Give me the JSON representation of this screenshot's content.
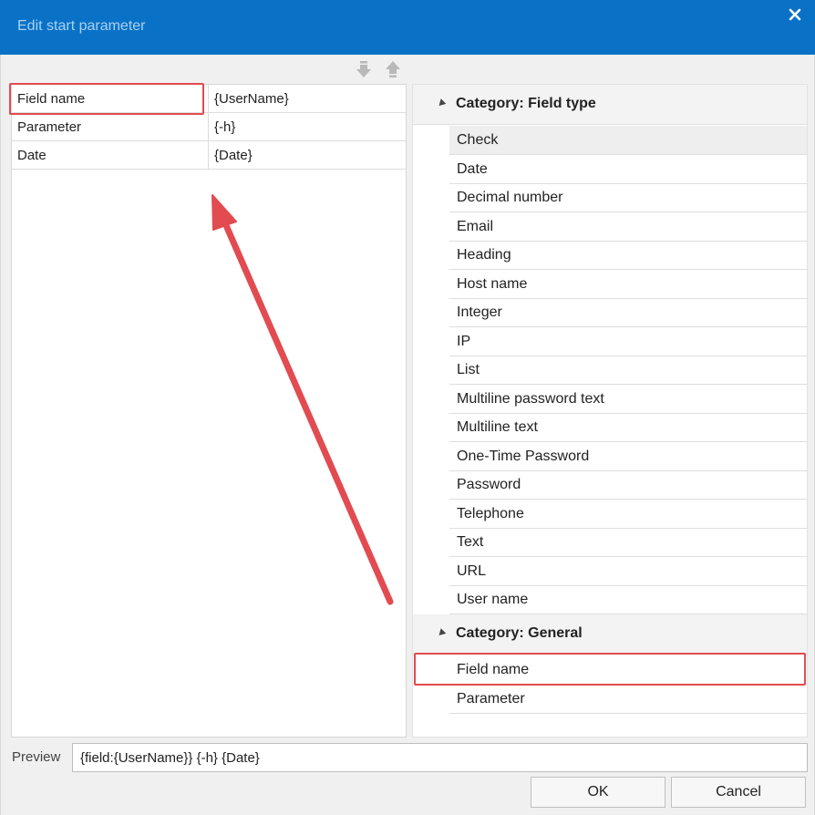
{
  "window": {
    "title": "Edit start parameter",
    "accent_color": "#0a72c6",
    "highlight_color": "#e24b50"
  },
  "toolbar": {
    "move_down_icon": "arrow-down-icon",
    "move_up_icon": "arrow-up-icon"
  },
  "parameters": [
    {
      "name": "Field name",
      "value": "{UserName}"
    },
    {
      "name": "Parameter",
      "value": "{-h}"
    },
    {
      "name": "Date",
      "value": "{Date}"
    }
  ],
  "categories": {
    "field_type": {
      "label": "Category: Field type",
      "items": [
        "Check",
        "Date",
        "Decimal number",
        "Email",
        "Heading",
        "Host name",
        "Integer",
        "IP",
        "List",
        "Multiline password text",
        "Multiline text",
        "One-Time Password",
        "Password",
        "Telephone",
        "Text",
        "URL",
        "User name"
      ]
    },
    "general": {
      "label": "Category: General",
      "items": [
        "Field name",
        "Parameter"
      ]
    }
  },
  "preview": {
    "label": "Preview",
    "value": "{field:{UserName}} {-h} {Date}"
  },
  "buttons": {
    "ok": "OK",
    "cancel": "Cancel"
  }
}
